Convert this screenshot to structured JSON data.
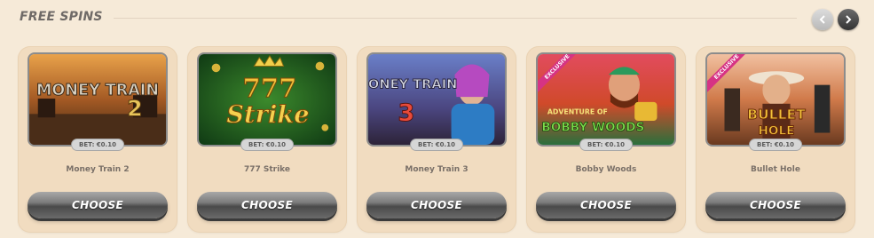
{
  "section": {
    "title": "FREE SPINS"
  },
  "nav": {
    "prev_icon": "chevron-left-icon",
    "next_icon": "chevron-right-icon"
  },
  "cards": [
    {
      "name": "Money Train 2",
      "bet": "BET: €0.10",
      "button": "CHOOSE",
      "art_title": "MONEY TRAIN",
      "art_sub": "2"
    },
    {
      "name": "777 Strike",
      "bet": "BET: €0.10",
      "button": "CHOOSE",
      "art_title": "777",
      "art_sub": "Strike"
    },
    {
      "name": "Money Train 3",
      "bet": "BET: €0.10",
      "button": "CHOOSE",
      "art_title": "MONEY TRAIN",
      "art_sub": "3"
    },
    {
      "name": "Bobby Woods",
      "bet": "BET: €0.10",
      "button": "CHOOSE",
      "art_title": "ADVENTURE OF",
      "art_sub": "BOBBY WOODS",
      "ribbon": "EXCLUSIVE"
    },
    {
      "name": "Bullet Hole",
      "bet": "BET: €0.10",
      "button": "CHOOSE",
      "art_title": "BULLET",
      "art_sub": "HOLE",
      "ribbon": "EXCLUSIVE"
    }
  ]
}
